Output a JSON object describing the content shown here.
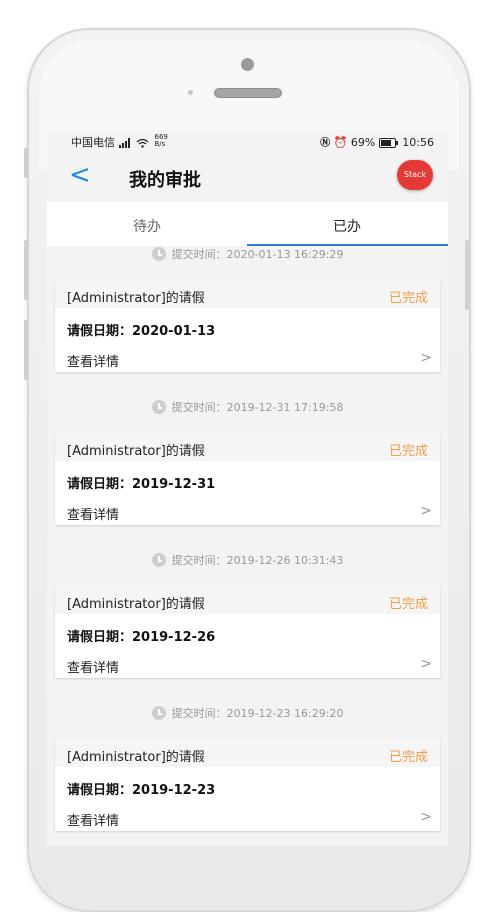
{
  "status_bar": {
    "carrier": "中国电信",
    "network_speed": "669\nB/s",
    "battery_percent": "69%",
    "time": "10:56"
  },
  "navbar": {
    "back_icon": "chevron-left-icon",
    "title": "我的审批",
    "stack_label": "Stack"
  },
  "tabs": [
    {
      "label": "待办",
      "active": false
    },
    {
      "label": "已办",
      "active": true
    }
  ],
  "records": [
    {
      "submit_time": "提交时间：2020-01-13 16:29:29",
      "title": "[Administrator]的请假",
      "status": "已完成",
      "leave_date": "请假日期：2020-01-13",
      "detail": "查看详情"
    },
    {
      "submit_time": "提交时间：2019-12-31 17:19:58",
      "title": "[Administrator]的请假",
      "status": "已完成",
      "leave_date": "请假日期：2019-12-31",
      "detail": "查看详情"
    },
    {
      "submit_time": "提交时间：2019-12-26 10:31:43",
      "title": "[Administrator]的请假",
      "status": "已完成",
      "leave_date": "请假日期：2019-12-26",
      "detail": "查看详情"
    },
    {
      "submit_time": "提交时间：2019-12-23 16:29:20",
      "title": "[Administrator]的请假",
      "status": "已完成",
      "leave_date": "请假日期：2019-12-23",
      "detail": "查看详情"
    }
  ],
  "colors": {
    "accent": "#2e7bd6",
    "status_done": "#f0a04b",
    "stack_button": "#e53935"
  }
}
